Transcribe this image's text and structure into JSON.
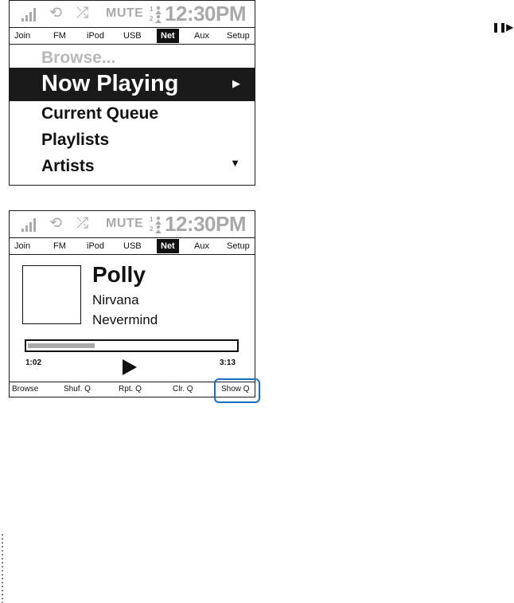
{
  "status_bar": {
    "mute_label": "MUTE",
    "zone_top": "1",
    "zone_bottom": "2",
    "clock": "12:30PM",
    "icons": [
      "signal-icon",
      "repeat-icon",
      "shuffle-icon",
      "zone-icon"
    ]
  },
  "tabs": [
    {
      "label": "Join"
    },
    {
      "label": "FM"
    },
    {
      "label": "iPod"
    },
    {
      "label": "USB"
    },
    {
      "label": "Net",
      "active": true
    },
    {
      "label": "Aux"
    },
    {
      "label": "Setup"
    }
  ],
  "browse_menu": {
    "items": [
      {
        "label": "Browse..."
      },
      {
        "label": "Now Playing"
      },
      {
        "label": "Current Queue"
      },
      {
        "label": "Playlists"
      },
      {
        "label": "Artists"
      }
    ],
    "selected_index": 1
  },
  "now_playing": {
    "song": "Polly",
    "artist": "Nirvana",
    "album": "Nevermind",
    "elapsed": "1:02",
    "duration": "3:13",
    "progress_fraction": 0.32
  },
  "softkeys": [
    "Browse",
    "Shuf. Q",
    "Rpt. Q",
    "Clr. Q",
    "Show Q"
  ],
  "highlighted_softkey": "Show Q",
  "colors": {
    "highlight": "#1a6fc0",
    "dim": "#a9a9a9"
  }
}
